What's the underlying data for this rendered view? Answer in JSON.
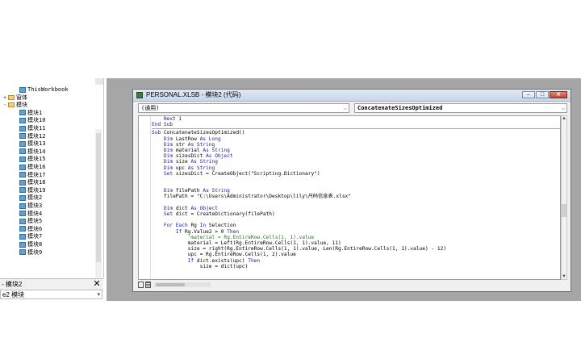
{
  "project_tree": {
    "items": [
      {
        "label": "ThisWorkbook",
        "icon": "excel-object-icon",
        "indent": 1,
        "expander": ""
      },
      {
        "label": "窗体",
        "icon": "folder-icon",
        "indent": 0,
        "expander": "+"
      },
      {
        "label": "模块",
        "icon": "folder-icon",
        "indent": 0,
        "expander": "-"
      },
      {
        "label": "模块1",
        "icon": "module-icon",
        "indent": 1,
        "expander": ""
      },
      {
        "label": "模块10",
        "icon": "module-icon",
        "indent": 1,
        "expander": ""
      },
      {
        "label": "模块11",
        "icon": "module-icon",
        "indent": 1,
        "expander": ""
      },
      {
        "label": "模块12",
        "icon": "module-icon",
        "indent": 1,
        "expander": ""
      },
      {
        "label": "模块13",
        "icon": "module-icon",
        "indent": 1,
        "expander": ""
      },
      {
        "label": "模块14",
        "icon": "module-icon",
        "indent": 1,
        "expander": ""
      },
      {
        "label": "模块15",
        "icon": "module-icon",
        "indent": 1,
        "expander": ""
      },
      {
        "label": "模块16",
        "icon": "module-icon",
        "indent": 1,
        "expander": ""
      },
      {
        "label": "模块17",
        "icon": "module-icon",
        "indent": 1,
        "expander": ""
      },
      {
        "label": "模块18",
        "icon": "module-icon",
        "indent": 1,
        "expander": ""
      },
      {
        "label": "模块19",
        "icon": "module-icon",
        "indent": 1,
        "expander": ""
      },
      {
        "label": "模块2",
        "icon": "module-icon",
        "indent": 1,
        "expander": ""
      },
      {
        "label": "模块3",
        "icon": "module-icon",
        "indent": 1,
        "expander": ""
      },
      {
        "label": "模块4",
        "icon": "module-icon",
        "indent": 1,
        "expander": ""
      },
      {
        "label": "模块5",
        "icon": "module-icon",
        "indent": 1,
        "expander": ""
      },
      {
        "label": "模块6",
        "icon": "module-icon",
        "indent": 1,
        "expander": ""
      },
      {
        "label": "模块7",
        "icon": "module-icon",
        "indent": 1,
        "expander": ""
      },
      {
        "label": "模块8",
        "icon": "module-icon",
        "indent": 1,
        "expander": ""
      },
      {
        "label": "模块9",
        "icon": "module-icon",
        "indent": 1,
        "expander": ""
      }
    ]
  },
  "properties": {
    "title": "- 模块2",
    "close_label": "✕",
    "selected": "e2 模块"
  },
  "code_window": {
    "title": "PERSONAL.XLSB - 模块2 (代码)",
    "min_label": "–",
    "max_label": "□",
    "close_label": "✕",
    "object_combo": "(通用)",
    "proc_combo": "ConcatenateSizesOptimized",
    "lines": [
      {
        "segments": [
          {
            "t": "    ",
            "c": ""
          },
          {
            "t": "Next",
            "c": "kw"
          },
          {
            "t": " i",
            "c": ""
          }
        ]
      },
      {
        "segments": [
          {
            "t": "End Sub",
            "c": "kw"
          }
        ]
      },
      {
        "divider": true
      },
      {
        "segments": [
          {
            "t": "Sub",
            "c": "kw"
          },
          {
            "t": " ConcatenateSizesOptimized()",
            "c": ""
          }
        ]
      },
      {
        "segments": [
          {
            "t": "    ",
            "c": ""
          },
          {
            "t": "Dim",
            "c": "kw"
          },
          {
            "t": " LastRow ",
            "c": ""
          },
          {
            "t": "As Long",
            "c": "kw"
          }
        ]
      },
      {
        "segments": [
          {
            "t": "    ",
            "c": ""
          },
          {
            "t": "Dim",
            "c": "kw"
          },
          {
            "t": " str ",
            "c": ""
          },
          {
            "t": "As String",
            "c": "kw"
          }
        ]
      },
      {
        "segments": [
          {
            "t": "    ",
            "c": ""
          },
          {
            "t": "Dim",
            "c": "kw"
          },
          {
            "t": " material ",
            "c": ""
          },
          {
            "t": "As String",
            "c": "kw"
          }
        ]
      },
      {
        "segments": [
          {
            "t": "    ",
            "c": ""
          },
          {
            "t": "Dim",
            "c": "kw"
          },
          {
            "t": " sizesDict ",
            "c": ""
          },
          {
            "t": "As Object",
            "c": "kw"
          }
        ]
      },
      {
        "segments": [
          {
            "t": "    ",
            "c": ""
          },
          {
            "t": "Dim",
            "c": "kw"
          },
          {
            "t": " size ",
            "c": ""
          },
          {
            "t": "As String",
            "c": "kw"
          }
        ]
      },
      {
        "segments": [
          {
            "t": "    ",
            "c": ""
          },
          {
            "t": "Dim",
            "c": "kw"
          },
          {
            "t": " upc ",
            "c": ""
          },
          {
            "t": "As String",
            "c": "kw"
          }
        ]
      },
      {
        "segments": [
          {
            "t": "    ",
            "c": ""
          },
          {
            "t": "Set",
            "c": "kw"
          },
          {
            "t": " sizesDict = CreateObject(\"Scripting.Dictionary\")",
            "c": ""
          }
        ]
      },
      {
        "segments": [
          {
            "t": "",
            "c": ""
          }
        ]
      },
      {
        "segments": [
          {
            "t": "",
            "c": ""
          }
        ]
      },
      {
        "segments": [
          {
            "t": "    ",
            "c": ""
          },
          {
            "t": "Dim",
            "c": "kw"
          },
          {
            "t": " filePath ",
            "c": ""
          },
          {
            "t": "As String",
            "c": "kw"
          }
        ]
      },
      {
        "segments": [
          {
            "t": "    filePath = \"C:\\Users\\Administrator\\Desktop\\lily\\尺码信息表.xlsx\"",
            "c": ""
          }
        ]
      },
      {
        "segments": [
          {
            "t": "",
            "c": ""
          }
        ]
      },
      {
        "segments": [
          {
            "t": "    ",
            "c": ""
          },
          {
            "t": "Dim",
            "c": "kw"
          },
          {
            "t": " dict ",
            "c": ""
          },
          {
            "t": "As Object",
            "c": "kw"
          }
        ]
      },
      {
        "segments": [
          {
            "t": "    ",
            "c": ""
          },
          {
            "t": "Set",
            "c": "kw"
          },
          {
            "t": " dict = CreateDictionary(filePath)",
            "c": ""
          }
        ]
      },
      {
        "segments": [
          {
            "t": "",
            "c": ""
          }
        ]
      },
      {
        "segments": [
          {
            "t": "    ",
            "c": ""
          },
          {
            "t": "For Each",
            "c": "kw"
          },
          {
            "t": " Rg ",
            "c": ""
          },
          {
            "t": "In",
            "c": "kw"
          },
          {
            "t": " Selection",
            "c": ""
          }
        ]
      },
      {
        "segments": [
          {
            "t": "        ",
            "c": ""
          },
          {
            "t": "If",
            "c": "kw"
          },
          {
            "t": " Rg.Value2 > 0 ",
            "c": ""
          },
          {
            "t": "Then",
            "c": "kw"
          }
        ]
      },
      {
        "segments": [
          {
            "t": "            'material = Rg.EntireRow.Cells(1, 1).value",
            "c": "cm"
          }
        ]
      },
      {
        "segments": [
          {
            "t": "            material = Left(Rg.EntireRow.Cells(1, 1).value, 11)",
            "c": ""
          }
        ]
      },
      {
        "segments": [
          {
            "t": "            size = right(Rg.EntireRow.Cells(1, 1).value, Len(Rg.EntireRow.Cells(1, 1).value) - 12)",
            "c": ""
          }
        ]
      },
      {
        "segments": [
          {
            "t": "            upc = Rg.EntireRow.Cells(1, 2).value",
            "c": ""
          }
        ]
      },
      {
        "segments": [
          {
            "t": "            ",
            "c": ""
          },
          {
            "t": "If",
            "c": "kw"
          },
          {
            "t": " dict.exists(upc) ",
            "c": ""
          },
          {
            "t": "Then",
            "c": "kw"
          }
        ]
      },
      {
        "segments": [
          {
            "t": "                size = dict(upc)",
            "c": ""
          }
        ]
      }
    ]
  },
  "colors": {
    "keyword": "#1c1ca8",
    "comment": "#1f7a1f",
    "mdi_background": "#a6a6a6",
    "title_gradient_top": "#dfe8f3",
    "close_button": "#c2442c"
  }
}
